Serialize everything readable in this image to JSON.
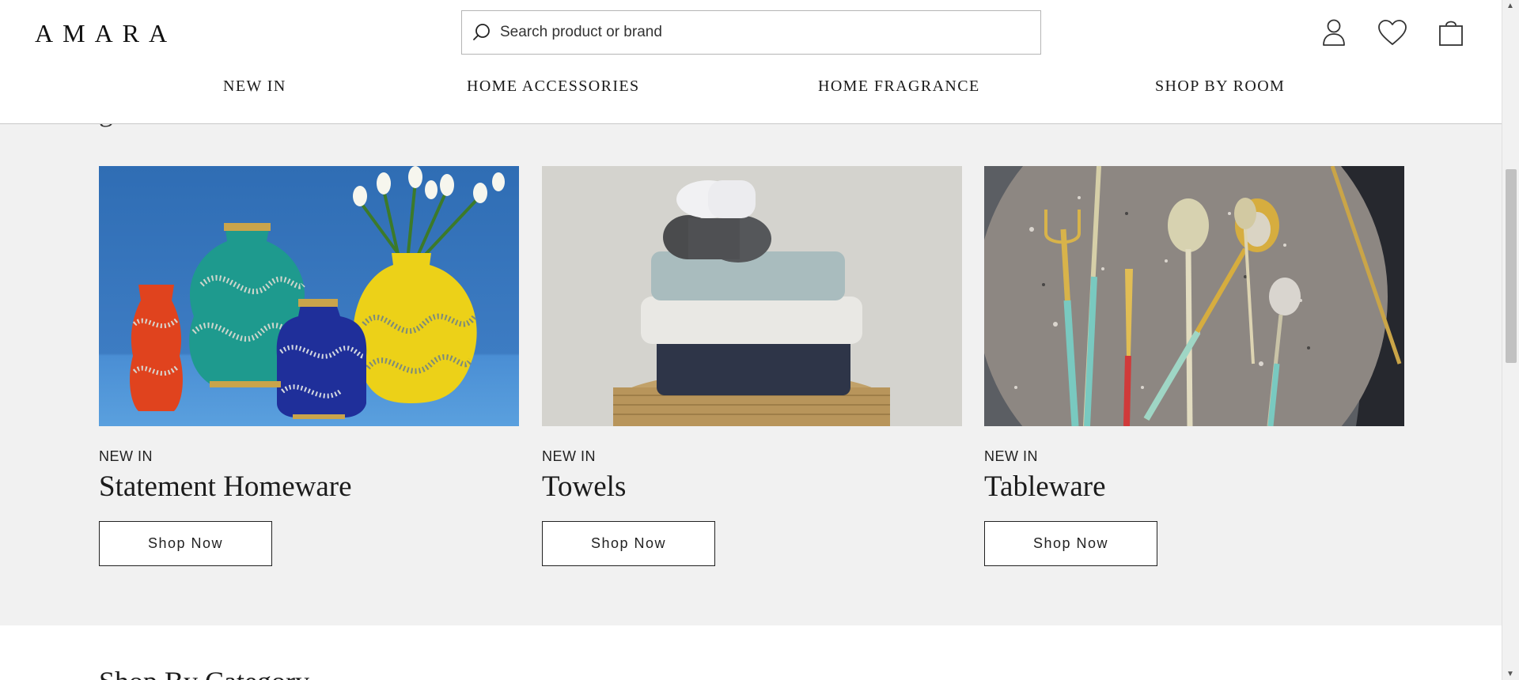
{
  "header": {
    "logo": "AMARA",
    "search_placeholder": "Search product or brand",
    "icons": [
      "user-icon",
      "heart-icon",
      "bag-icon"
    ]
  },
  "nav": {
    "items": [
      "NEW IN",
      "HOME ACCESSORIES",
      "HOME FRAGRANCE",
      "SHOP BY ROOM"
    ]
  },
  "section": {
    "partial_heading": "g"
  },
  "cards": [
    {
      "kicker": "NEW IN",
      "title": "Statement Homeware",
      "button": "Shop Now"
    },
    {
      "kicker": "NEW IN",
      "title": "Towels",
      "button": "Shop Now"
    },
    {
      "kicker": "NEW IN",
      "title": "Tableware",
      "button": "Shop Now"
    }
  ],
  "bottom": {
    "heading": "Shop By Category"
  },
  "colors": {
    "background": "#f1f1f1",
    "header": "#ffffff",
    "text": "#1a1a1a"
  }
}
